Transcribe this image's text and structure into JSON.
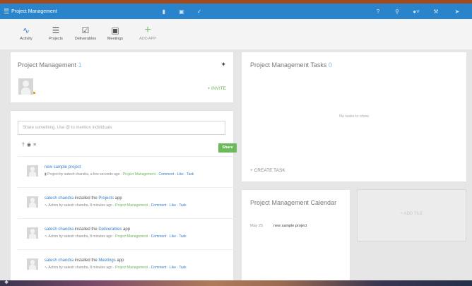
{
  "topbar": {
    "menu_icon": "hamburger-icon",
    "title": "Project Management",
    "center_icons": [
      "page-icon",
      "calendar-icon",
      "check-icon"
    ],
    "right_icons": [
      "help-icon",
      "search-icon",
      "user-icon",
      "tools-icon",
      "rocket-icon"
    ]
  },
  "apps": [
    {
      "label": "Activity",
      "icon": "activity-icon",
      "glyph": "∿"
    },
    {
      "label": "Projects",
      "icon": "projects-icon",
      "glyph": "☰"
    },
    {
      "label": "Deliverables",
      "icon": "deliverables-icon",
      "glyph": "☑"
    },
    {
      "label": "Meetings",
      "icon": "meetings-icon",
      "glyph": "▣"
    },
    {
      "label": "ADD APP",
      "icon": "add-icon",
      "glyph": "+"
    }
  ],
  "pm_panel": {
    "title": "Project Management",
    "count": "1",
    "pin_icon": "pin-icon",
    "invite_label": "+ INVITE"
  },
  "tasks_panel": {
    "title": "Project Management Tasks",
    "count": "0",
    "empty_text": "No tasks to show",
    "create_label": "+ CREATE TASK"
  },
  "share": {
    "placeholder": "Share something. Use @ to mention individuals",
    "tools": "† ◉ ≡",
    "button_label": "Share"
  },
  "feed": [
    {
      "actor": "",
      "text": "",
      "link": "new sample project",
      "text2": "",
      "meta_icon": "▮",
      "meta": "Project by satesh chandra, a few seconds ago · ",
      "space": "Project Management",
      "actions": " · Comment · Like · Task"
    },
    {
      "actor": "satesh chandra",
      "text": " installed the ",
      "link": "Projects",
      "text2": " app",
      "meta_icon": "∿",
      "meta": "Action by satesh chandra, 8 minutes ago · ",
      "space": "Project Management",
      "actions": " · Comment · Like · Task"
    },
    {
      "actor": "satesh chandra",
      "text": " installed the ",
      "link": "Deliverables",
      "text2": " app",
      "meta_icon": "∿",
      "meta": "Action by satesh chandra, 8 minutes ago · ",
      "space": "Project Management",
      "actions": " · Comment · Like · Task"
    },
    {
      "actor": "satesh chandra",
      "text": " installed the ",
      "link": "Meetings",
      "text2": " app",
      "meta_icon": "∿",
      "meta": "Action by satesh chandra, 8 minutes ago · ",
      "space": "Project Management",
      "actions": " · Comment · Like · Task"
    }
  ],
  "calendar": {
    "title": "Project Management Calendar",
    "date": "May 25",
    "event": "new sample project"
  },
  "tile": {
    "add_label": "+ ADD TILE"
  }
}
